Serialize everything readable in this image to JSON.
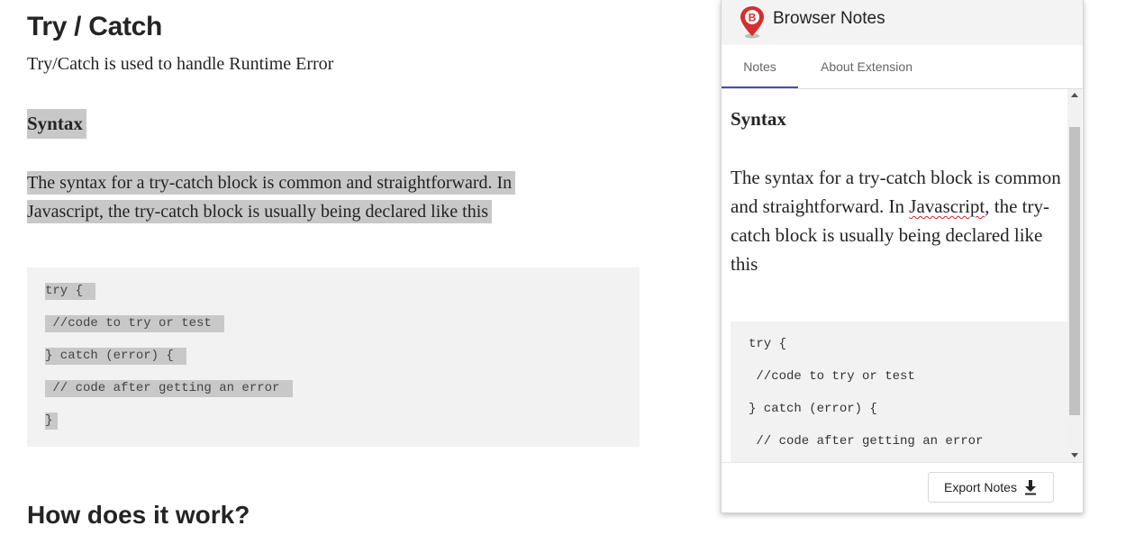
{
  "article": {
    "title": "Try / Catch",
    "intro": "Try/Catch is used to handle Runtime Error",
    "syntax_heading": "Syntax",
    "paragraph_line1": "The syntax for a try-catch block is common and straightforward. In",
    "paragraph_line2": "Javascript, the try-catch block is usually being declared like this",
    "code_lines": [
      "try { ",
      " //code to try or test ",
      "} catch (error) { ",
      " // code after getting an error ",
      "}"
    ],
    "next_heading": "How does it work?"
  },
  "popup": {
    "title": "Browser Notes",
    "logo_letter": "B",
    "tabs": [
      "Notes",
      "About Extension"
    ],
    "active_tab": "Notes",
    "note": {
      "heading": "Syntax",
      "para_before": "The syntax for a try-catch block is common and straightforward. In ",
      "misspelled": "Javascript",
      "para_after": ", the try-catch block is usually being declared like this",
      "code_lines": [
        "try {",
        " //code to try or test",
        "} catch (error) {",
        " // code after getting an error"
      ]
    },
    "export_label": "Export Notes"
  },
  "colors": {
    "highlight": "#c8c8c8",
    "code_bg": "#f2f2f2",
    "tab_indicator": "#3f51b5",
    "logo_red": "#d32f2f",
    "spell_underline": "#e02020"
  },
  "icons": [
    "browser-notes-logo-icon",
    "download-icon",
    "scroll-up-arrow-icon",
    "scroll-down-arrow-icon"
  ]
}
